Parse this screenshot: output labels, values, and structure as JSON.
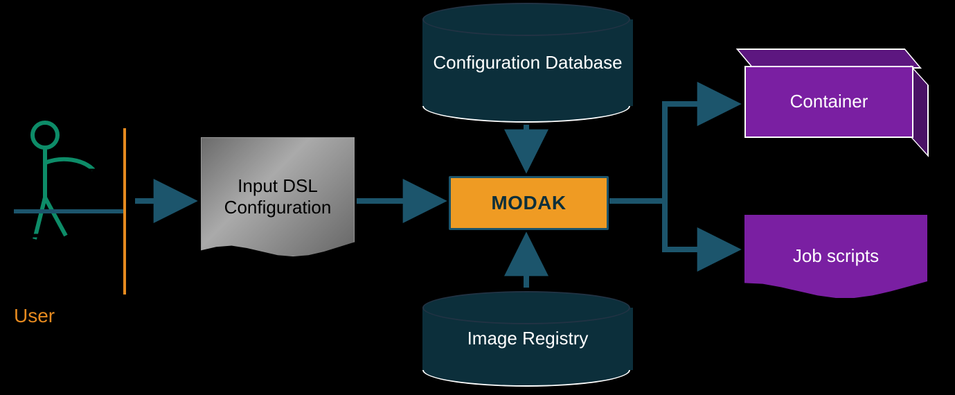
{
  "user_label": "User",
  "nodes": {
    "input_dsl": "Input DSL Configuration",
    "modak": "MODAK",
    "config_db": "Configuration Database",
    "image_registry": "Image Registry",
    "container": "Container",
    "job_scripts": "Job scripts"
  },
  "colors": {
    "arrow": "#1c556c",
    "db_fill": "#0c2f3b",
    "modak_fill": "#ef9b23",
    "purple": "#7a1fa2",
    "user_accent": "#0d8c68",
    "user_label": "#e68a1f"
  },
  "flow": {
    "edges": [
      {
        "from": "user",
        "to": "input_dsl"
      },
      {
        "from": "input_dsl",
        "to": "modak"
      },
      {
        "from": "config_db",
        "to": "modak"
      },
      {
        "from": "image_registry",
        "to": "modak"
      },
      {
        "from": "modak",
        "to": "container"
      },
      {
        "from": "modak",
        "to": "job_scripts"
      }
    ]
  }
}
